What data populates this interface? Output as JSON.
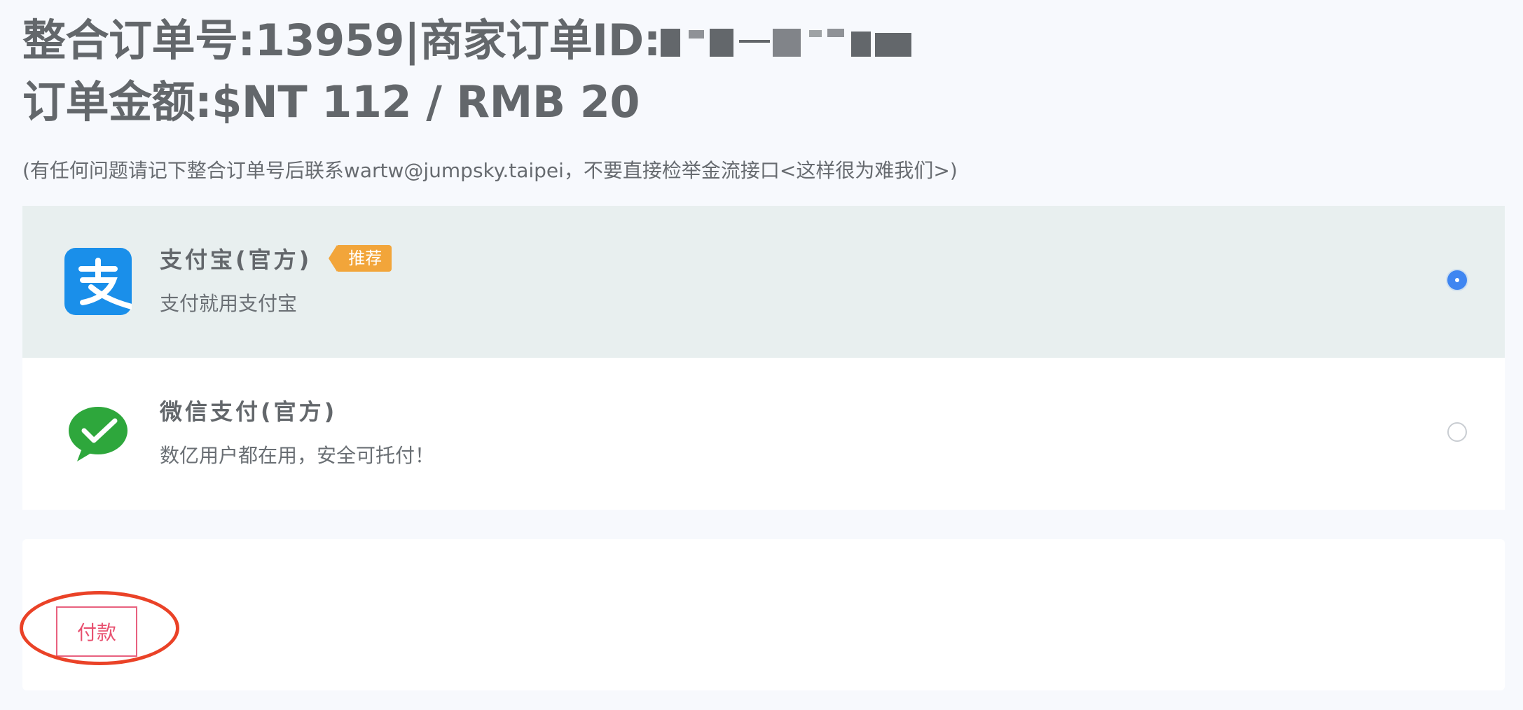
{
  "order": {
    "line1_prefix": "整合订单号:13959|商家订单ID:",
    "line2": "订单金额:$NT 112 / RMB 20"
  },
  "notice": "(有任何问题请记下整合订单号后联系wartw@jumpsky.taipei，不要直接检举金流接口<这样很为难我们>)",
  "methods": [
    {
      "name": "支付宝(官方)",
      "badge": "推荐",
      "desc": "支付就用支付宝",
      "selected": true,
      "icon": "alipay-logo-icon",
      "brand_color": "#1a8fea"
    },
    {
      "name": "微信支付(官方)",
      "desc": "数亿用户都在用，安全可托付！",
      "selected": false,
      "icon": "wechat-pay-logo-icon",
      "brand_color": "#2ea73c"
    }
  ],
  "pay_button_label": "付款",
  "colors": {
    "selected_row_bg": "#e8efef",
    "badge": "#f2a53a",
    "radio_active": "#3f86f1",
    "pay_button": "#e8506f",
    "annotation_ring": "#ea4227"
  }
}
